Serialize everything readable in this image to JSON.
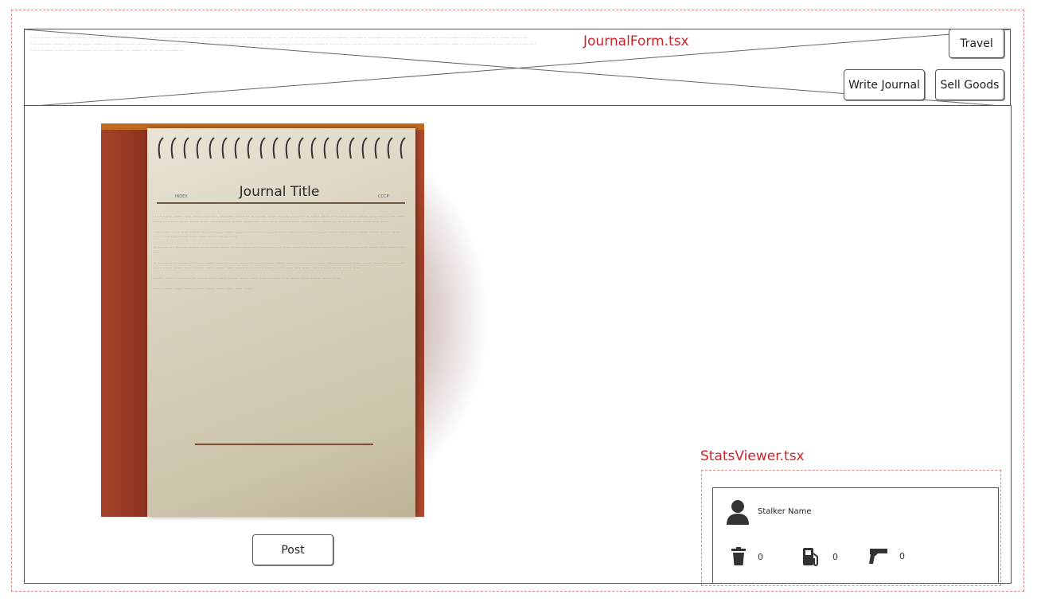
{
  "journal_form": {
    "component_label": "JournalForm.tsx",
    "buttons": {
      "travel": "Travel",
      "write_journal": "Write Journal",
      "sell_goods": "Sell Goods",
      "post": "Post"
    },
    "journal": {
      "title": "Journal Title",
      "index_label": "INDEX",
      "cccp_label": "CCCP"
    }
  },
  "stats_viewer": {
    "component_label": "StatsViewer.tsx",
    "player_name": "Stalker Name",
    "stats": [
      {
        "icon": "trash-icon",
        "value": "0"
      },
      {
        "icon": "fuel-icon",
        "value": "0"
      },
      {
        "icon": "gun-icon",
        "value": "0"
      }
    ]
  }
}
